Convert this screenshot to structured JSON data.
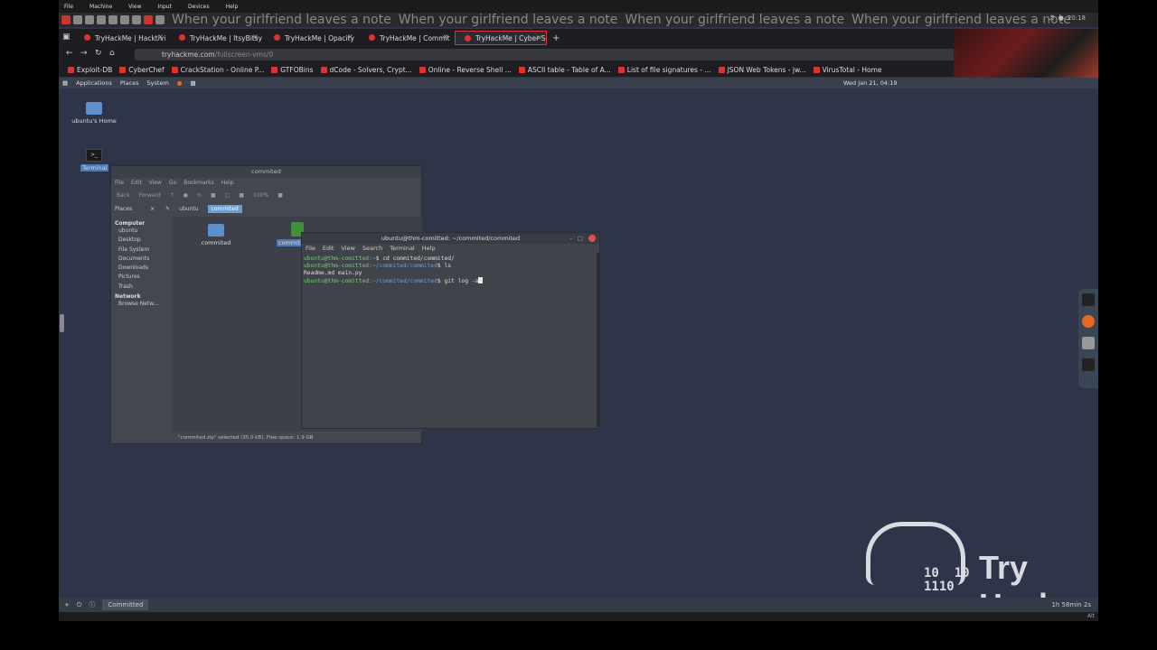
{
  "vm": {
    "menu": [
      "File",
      "Machine",
      "View",
      "Input",
      "Devices",
      "Help"
    ],
    "marquee": "When your girlfriend leaves a note",
    "tray_clock": "20:18"
  },
  "browser": {
    "tabs": [
      {
        "label": "TryHackMe | Hacktivi"
      },
      {
        "label": "TryHackMe | ItsyBitsy"
      },
      {
        "label": "TryHackMe | Opacity"
      },
      {
        "label": "TryHackMe | Commit"
      },
      {
        "label": "TryHackMe | Cyber Se"
      }
    ],
    "new_tab": "+",
    "url_host": "tryhackme.com",
    "url_path": "/fullscreen-vms/0",
    "bookmarks": [
      "Exploit-DB",
      "CyberChef",
      "CrackStation - Online P...",
      "GTFOBins",
      "dCode - Solvers, Crypt...",
      "Online - Reverse Shell ...",
      "ASCII table - Table of A...",
      "List of file signatures - ...",
      "JSON Web Tokens - jw...",
      "VirusTotal - Home"
    ]
  },
  "guest_panel": {
    "items": [
      "Applications",
      "Places",
      "System"
    ],
    "clock": "Wed Jan 21, 04:19"
  },
  "desktop": {
    "home_icon": "ubuntu's Home",
    "terminal_icon": "Terminal"
  },
  "file_manager": {
    "title": "commited",
    "menu": [
      "File",
      "Edit",
      "View",
      "Go",
      "Bookmarks",
      "Help"
    ],
    "toolbar": {
      "back": "Back",
      "forward": "Forward",
      "zoom": "100%"
    },
    "places_label": "Places",
    "crumbs": [
      "ubuntu",
      "commited"
    ],
    "sidebar": {
      "computer": "Computer",
      "computer_items": [
        "ubuntu",
        "Desktop",
        "File System",
        "Documents",
        "Downloads",
        "Pictures",
        "Trash"
      ],
      "network": "Network",
      "network_items": [
        "Browse Netw..."
      ]
    },
    "files": [
      "commited",
      "commited.zip"
    ],
    "status": "\"commited.zip\" selected (35.0 kB), Free space: 1.9 GB"
  },
  "terminal": {
    "title": "ubuntu@thm-comitted: ~/commited/commited",
    "menu": [
      "File",
      "Edit",
      "View",
      "Search",
      "Terminal",
      "Help"
    ],
    "lines": [
      {
        "prompt": "ubuntu@thm-comitted:",
        "path": "~",
        "cmd": "$ cd commited/commited/"
      },
      {
        "prompt": "ubuntu@thm-comitted:",
        "path": "~/commited/commited",
        "cmd": "$ ls"
      },
      {
        "output": "Readme.md  main.py"
      },
      {
        "prompt": "ubuntu@thm-comitted:",
        "path": "~/commited/commited",
        "cmd": "$ git log -a"
      }
    ]
  },
  "logo": {
    "word1": "Try",
    "word2": "Hack",
    "bits": "10  10\n1110"
  },
  "bottom_panel": {
    "task": "Committed",
    "session_time": "1h 58min 2s"
  },
  "host_tray": {
    "time": "Alt"
  }
}
